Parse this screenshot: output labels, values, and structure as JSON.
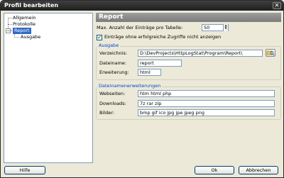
{
  "window": {
    "title": "Profil bearbeiten",
    "close_glyph": "✕"
  },
  "tree": {
    "items": [
      {
        "label": "Allgemein"
      },
      {
        "label": "Protokolle"
      },
      {
        "label": "Report",
        "expander": "−"
      },
      {
        "label": "Ausgabe"
      }
    ],
    "selected": "Report"
  },
  "page": {
    "header": "Report"
  },
  "settings": {
    "max_entries_label": "Max. Anzahl der Einträge pro Tabelle:",
    "max_entries_value": "50",
    "spin_up": "▲",
    "spin_down": "▼",
    "unsuccessful_checkbox_label": "Einträge ohne erfolgreiche Zugriffe nicht anzeigen",
    "unsuccessful_checked": true,
    "check_glyph": "✔"
  },
  "ausgabe": {
    "title": "Ausgabe",
    "directory_label": "Verzeichnis:",
    "directory_value": "D:\\DevProjects\\HttpLogStat\\Program\\Report\\",
    "filename_label": "Dateiname:",
    "filename_value": "report",
    "extension_label": "Erweiterung:",
    "extension_value": "html"
  },
  "extensions": {
    "title": "Dateinamenerweiterungen",
    "webpages_label": "Webseiten:",
    "webpages_value": "htm html php",
    "downloads_label": "Downloads:",
    "downloads_value": "7z rar zip",
    "images_label": "Bilder:",
    "images_value": "bmp gif ico jpg jpe jpeg png"
  },
  "buttons": {
    "help": "Hilfe",
    "ok": "Ok",
    "cancel": "Abbrechen"
  },
  "icons": {
    "browse": "browse-folder-icon"
  },
  "colors": {
    "selection": "#316ac5",
    "group_title": "#0046d5",
    "header": "#8a8a8a"
  }
}
